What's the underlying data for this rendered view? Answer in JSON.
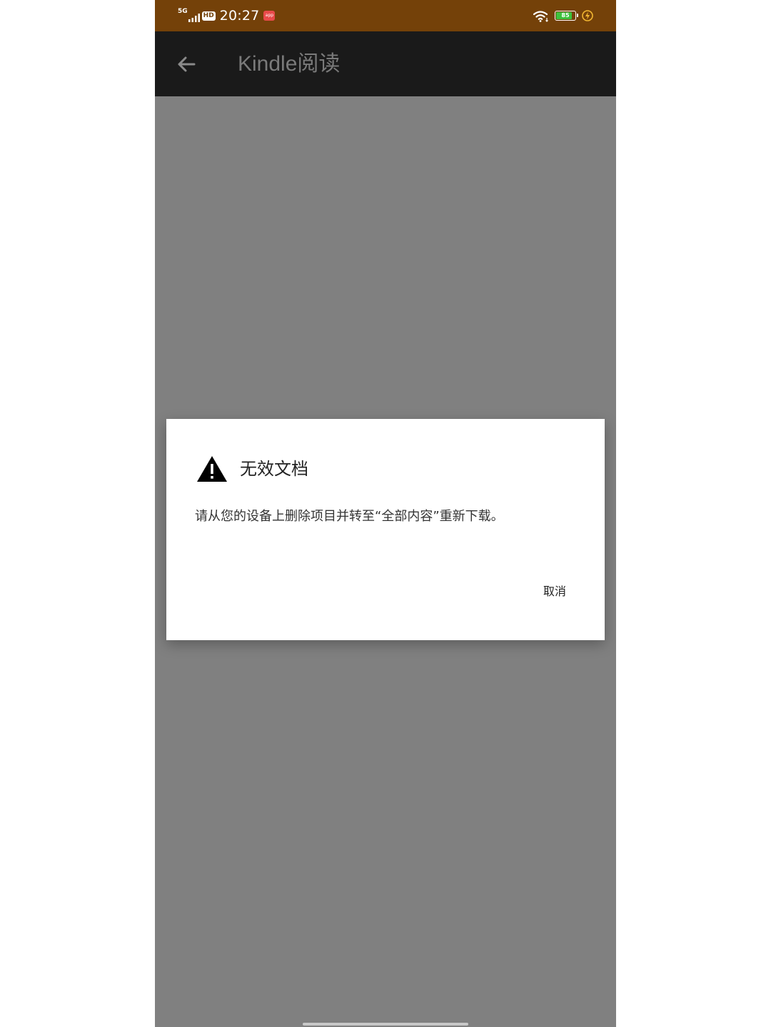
{
  "status_bar": {
    "network": "5G",
    "hd_label": "HD",
    "time": "20:27",
    "notification_label": "app",
    "battery_level": 85,
    "battery_text": "85"
  },
  "app_bar": {
    "title": "Kindle阅读",
    "back_icon": "arrow-left-icon"
  },
  "dialog": {
    "icon": "warning-icon",
    "title": "无效文档",
    "message": "请从您的设备上删除项目并转至“全部内容”重新下载。",
    "cancel_label": "取消"
  },
  "colors": {
    "status_bar_bg": "#744109",
    "app_bar_bg": "#1a1a1a",
    "scrim": "#808080",
    "dialog_bg": "#ffffff",
    "battery_fill": "#3dc23d",
    "charge_icon": "#f2b632"
  }
}
